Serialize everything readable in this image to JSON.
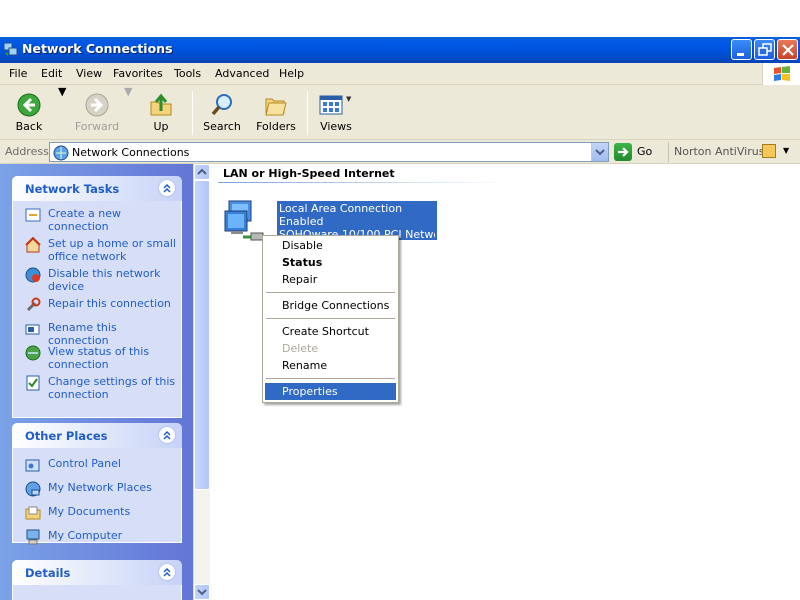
{
  "window": {
    "title": "Network Connections"
  },
  "menubar": {
    "items": [
      "File",
      "Edit",
      "View",
      "Favorites",
      "Tools",
      "Advanced",
      "Help"
    ]
  },
  "toolbar": {
    "back": "Back",
    "forward": "Forward",
    "up": "Up",
    "search": "Search",
    "folders": "Folders",
    "views": "Views"
  },
  "address": {
    "label": "Address",
    "value": "Network Connections",
    "go": "Go",
    "norton": "Norton AntiVirus"
  },
  "taskpane": {
    "network_tasks": {
      "title": "Network Tasks",
      "items": [
        {
          "label": "Create a new connection",
          "icon": "new-connection-icon"
        },
        {
          "label": "Set up a home or small office network",
          "icon": "home-network-icon"
        },
        {
          "label": "Disable this network device",
          "icon": "disable-device-icon"
        },
        {
          "label": "Repair this connection",
          "icon": "repair-icon"
        },
        {
          "label": "Rename this connection",
          "icon": "rename-icon"
        },
        {
          "label": "View status of this connection",
          "icon": "status-icon"
        },
        {
          "label": "Change settings of this connection",
          "icon": "settings-icon"
        }
      ]
    },
    "other_places": {
      "title": "Other Places",
      "items": [
        {
          "label": "Control Panel",
          "icon": "control-panel-icon"
        },
        {
          "label": "My Network Places",
          "icon": "network-places-icon"
        },
        {
          "label": "My Documents",
          "icon": "documents-icon"
        },
        {
          "label": "My Computer",
          "icon": "computer-icon"
        }
      ]
    },
    "details": {
      "title": "Details"
    }
  },
  "content": {
    "group_title": "LAN or High-Speed Internet",
    "connection": {
      "name": "Local Area Connection",
      "status": "Enabled",
      "device": "SOHOware 10/100 PCI Netwo..."
    }
  },
  "context_menu": {
    "items": [
      "Disable",
      "Status",
      "Repair",
      "Bridge Connections",
      "Create Shortcut",
      "Delete",
      "Rename",
      "Properties"
    ]
  },
  "colors": {
    "titlebar": "#0050d8",
    "selection": "#316ac5",
    "task_link": "#215dc6"
  }
}
